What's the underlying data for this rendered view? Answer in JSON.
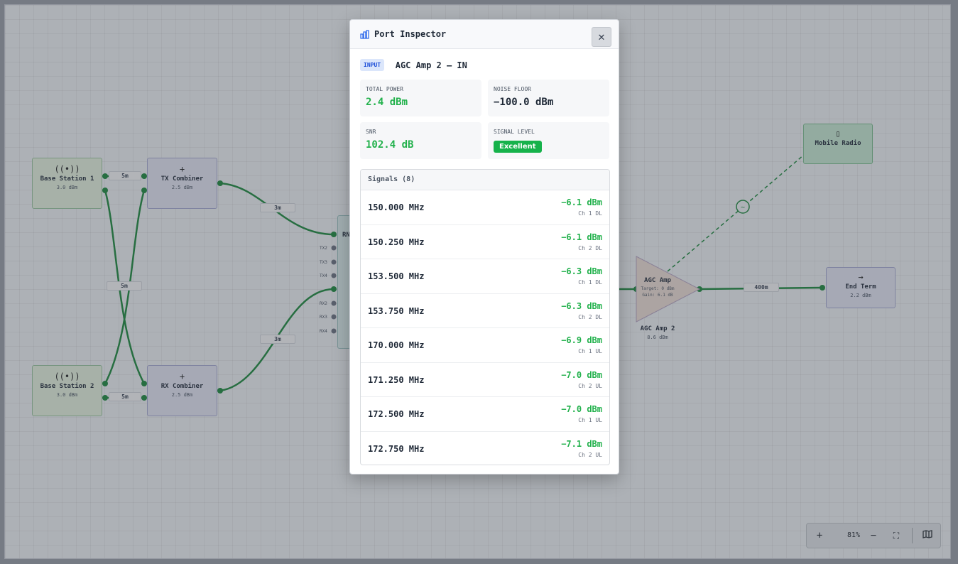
{
  "canvas": {
    "nodes": {
      "base_station_1": {
        "name": "Base Station 1",
        "sub": "3.0 dBm"
      },
      "base_station_2": {
        "name": "Base Station 2",
        "sub": "3.0 dBm"
      },
      "tx_combiner": {
        "name": "TX Combiner",
        "sub": "2.5 dBm"
      },
      "rx_combiner": {
        "name": "RX Combiner",
        "sub": "2.5 dBm"
      },
      "rn_label": "RN",
      "ports": [
        "TX2",
        "TX3",
        "TX4",
        "RX2",
        "RX3",
        "RX4"
      ],
      "agc_amp": {
        "name": "AGC Amp",
        "target": "Target: 0 dBm",
        "gain": "Gain: 6.1 dB",
        "label": "AGC Amp 2",
        "sub": "8.6 dBm"
      },
      "end_term": {
        "name": "End Term",
        "sub": "2.2 dBm"
      },
      "mobile_radio": {
        "name": "Mobile Radio"
      }
    },
    "cables": {
      "c1": "5m",
      "c2": "5m",
      "c3": "5m",
      "c4": "3m",
      "c5": "3m",
      "c6": "400m"
    }
  },
  "modal": {
    "title": "Port Inspector",
    "port_badge": "INPUT",
    "port_name": "AGC Amp 2 – IN",
    "stats": {
      "total_power": {
        "label": "TOTAL POWER",
        "value": "2.4 dBm"
      },
      "noise_floor": {
        "label": "NOISE FLOOR",
        "value": "−100.0 dBm"
      },
      "snr": {
        "label": "SNR",
        "value": "102.4 dB"
      },
      "signal_level": {
        "label": "SIGNAL LEVEL",
        "value": "Excellent"
      }
    },
    "signals_header": "Signals (8)",
    "signals": [
      {
        "freq": "150.000 MHz",
        "power": "−6.1 dBm",
        "channel": "Ch 1 DL"
      },
      {
        "freq": "150.250 MHz",
        "power": "−6.1 dBm",
        "channel": "Ch 2 DL"
      },
      {
        "freq": "153.500 MHz",
        "power": "−6.3 dBm",
        "channel": "Ch 1 DL"
      },
      {
        "freq": "153.750 MHz",
        "power": "−6.3 dBm",
        "channel": "Ch 2 DL"
      },
      {
        "freq": "170.000 MHz",
        "power": "−6.9 dBm",
        "channel": "Ch 1 UL"
      },
      {
        "freq": "171.250 MHz",
        "power": "−7.0 dBm",
        "channel": "Ch 2 UL"
      },
      {
        "freq": "172.500 MHz",
        "power": "−7.0 dBm",
        "channel": "Ch 1 UL"
      },
      {
        "freq": "172.750 MHz",
        "power": "−7.1 dBm",
        "channel": "Ch 2 UL"
      }
    ]
  },
  "toolbar": {
    "zoom": "81%",
    "zoom_in": "+",
    "zoom_out": "−"
  },
  "colors": {
    "wire": "#1a8a3a",
    "signal_green": "#22b14c",
    "badge_blue": "#1d4ed8"
  }
}
